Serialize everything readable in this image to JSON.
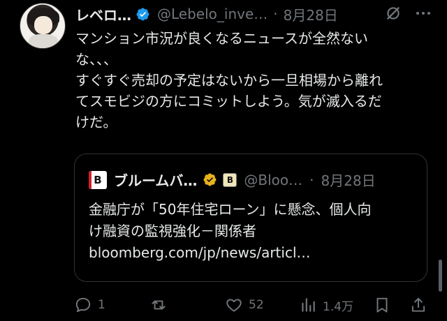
{
  "tweet": {
    "author_name": "レベロ…",
    "handle": "@Lebelo_inve…",
    "separator": "·",
    "date": "8月28日",
    "text": "マンション市況が良くなるニュースが全然ない\nな、、、\nすぐすぐ売却の予定はないから一旦相場から離れ\nてスモビジの方にコミットしよう。気が滅入るだ\nけだ。",
    "icons": [
      "grok-icon",
      "more-icon"
    ]
  },
  "quote": {
    "logo_letter": "B",
    "name": "ブルームバ…",
    "affiliate_letter": "B",
    "handle": "@Bloo…",
    "separator": "·",
    "date": "8月28日",
    "line1": "金融庁が「50年住宅ローン」に懸念、個人向",
    "line2": "け融資の監視強化－関係者",
    "link": "bloomberg.com/jp/news/articl…",
    "colors": {
      "logo_red": "#d21f2f",
      "gold_badge": "#e8b21c"
    }
  },
  "actions": {
    "reply_count": "1",
    "repost_count": "",
    "like_count": "52",
    "views_count": "1.4万"
  },
  "colors": {
    "accent_blue": "#1d9bf0",
    "muted": "#71767b",
    "border": "#2f3336"
  }
}
